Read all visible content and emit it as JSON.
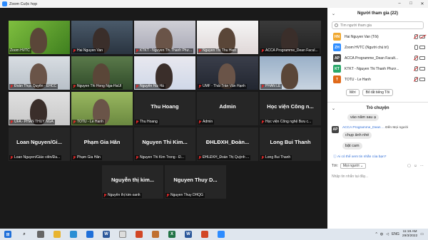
{
  "window": {
    "title": "Zoom Cuộc họp",
    "controls": [
      "–",
      "□",
      "✕"
    ]
  },
  "tiles": [
    {
      "label": "Zoom HVTC",
      "muted": false,
      "center": "",
      "active": true
    },
    {
      "label": "Hai Nguyen Van",
      "muted": true,
      "center": ""
    },
    {
      "label": "KTKT - Nguyen Thi Thanh Phư...",
      "muted": true,
      "center": ""
    },
    {
      "label": "Nguyen Thi Thu Hien",
      "muted": true,
      "center": ""
    },
    {
      "label": "ACCA Programme_Dean Facul...",
      "muted": true,
      "center": ""
    },
    {
      "label": "Đoàn Thục Quyên - EHCC",
      "muted": true,
      "center": ""
    },
    {
      "label": "Nguyen Thi Hong Nga-HaUI",
      "muted": true,
      "center": ""
    },
    {
      "label": "Nguyễn Hải Hà",
      "muted": true,
      "center": ""
    },
    {
      "label": "UMF - Thái Trần Văn Hạnh",
      "muted": true,
      "center": ""
    },
    {
      "label": "PHAN LE",
      "muted": true,
      "center": ""
    },
    {
      "label": "UFA - PHAN THUY NGA",
      "muted": true,
      "center": ""
    },
    {
      "label": "TOTU - Le Hanh",
      "muted": true,
      "center": ""
    },
    {
      "label": "Thu Hoang",
      "muted": true,
      "center": "Thu Hoang"
    },
    {
      "label": "Admin",
      "muted": true,
      "center": "Admin"
    },
    {
      "label": "Học viện Công nghệ Bưu c...",
      "muted": true,
      "center": "Học viện Công n..."
    },
    {
      "label": "Loan Nguyen/Giáo viên/Đa...",
      "muted": true,
      "center": "Loan Nguyen/Gi..."
    },
    {
      "label": "Phạm Gia Hân",
      "muted": true,
      "center": "Phạm Gia Hân"
    },
    {
      "label": "Nguyen Thi Kim Trong - Đ...",
      "muted": true,
      "center": "Nguyen Thi Kim..."
    },
    {
      "label": "ĐHLĐXH_Đoàn Thị Quỳnh ...",
      "muted": true,
      "center": "ĐHLĐXH_Đoàn..."
    },
    {
      "label": "Long Bui Thanh",
      "muted": true,
      "center": "Long Bui Thanh"
    },
    {
      "label": "Nguyễn thị kim oanh",
      "muted": true,
      "center": "Nguyễn thị kim..."
    },
    {
      "label": "Nguyen Thuy DHQG",
      "muted": true,
      "center": "Nguyen Thuy D..."
    }
  ],
  "participants": {
    "title": "Người tham gia (22)",
    "search_placeholder": "Tìm người tham gia",
    "list": [
      {
        "initials": "HN",
        "color": "#f0a830",
        "name": "Hai Nguyen Van (Tôi)",
        "mic_muted": true,
        "cam_muted": true
      },
      {
        "initials": "ZH",
        "color": "#2d8cff",
        "name": "Zoom HVTC (Người chủ trì)",
        "mic_muted": false,
        "cam_muted": false
      },
      {
        "initials": "AP",
        "color": "#444444",
        "name": "ACCA Programme_Dean Facult...",
        "mic_muted": true,
        "cam_muted": false
      },
      {
        "initials": "KT",
        "color": "#2aa86a",
        "name": "KTKT - Nguyen Thi Thanh Phươ...",
        "mic_muted": true,
        "cam_muted": false
      },
      {
        "initials": "T",
        "color": "#e06a1a",
        "name": "TOTU - Le Hanh",
        "mic_muted": true,
        "cam_muted": false
      }
    ],
    "invite_label": "Mời",
    "unmute_label": "Bỏ tắt tiếng Tôi"
  },
  "chat": {
    "title": "Trò chuyện",
    "msg1": "vào năm sau ạ",
    "sender_initials": "AP",
    "sender_name": "ACCA Programme_Dean ...",
    "sender_to": "Đến Mọi người",
    "msg2": "chụp ảnh nhé",
    "msg3": "bật cam",
    "info": "Ai có thể xem tin nhắn của bạn?",
    "to_label": "Tới:",
    "to_value": "Mọi người",
    "input_placeholder": "Nhập tin nhắn tại đây..."
  },
  "taskbar": {
    "lang": "ENG",
    "time": "11:19 AM",
    "date": "29/3/2022"
  }
}
